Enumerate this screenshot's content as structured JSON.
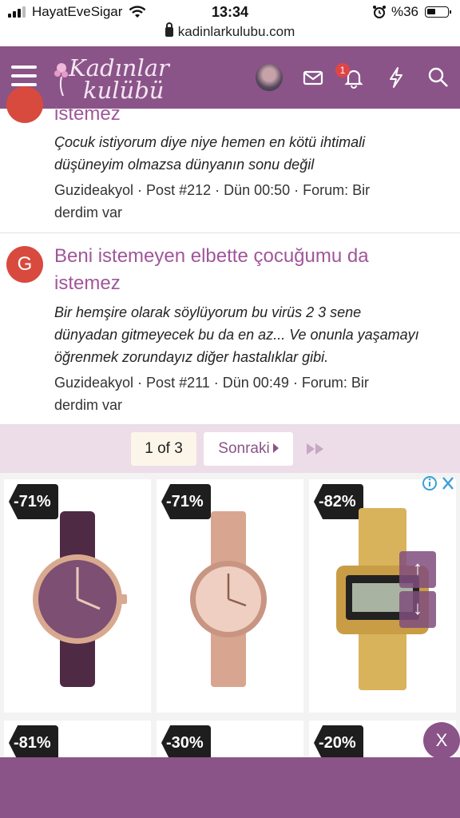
{
  "status_bar": {
    "carrier": "HayatEveSigar",
    "time": "13:34",
    "battery": "%36"
  },
  "browser": {
    "url": "kadinlarkulubu.com"
  },
  "header": {
    "logo_line1": "Kadınlar",
    "logo_line2": "kulübü",
    "notification_count": "1"
  },
  "results": [
    {
      "title_partial": "istemez",
      "snippet_line1": "Çocuk istiyorum diye niye hemen en kötü ihtimali",
      "snippet_line2": "düşüneyim olmazsa dünyanın sonu değil",
      "meta_line1": "Guzideakyol · Post #212 · Dün 00:50 · Forum: Bir",
      "meta_line2": "derdim var"
    },
    {
      "avatar_letter": "G",
      "title_line1": "Beni istemeyen elbette çocuğumu da",
      "title_line2": "istemez",
      "snippet_line1": "Bir hemşire olarak söylüyorum bu virüs 2 3 sene",
      "snippet_line2": "dünyadan gitmeyecek bu da en az... Ve onunla yaşamayı",
      "snippet_line3": "öğrenmek zorundayız diğer hastalıklar gibi.",
      "meta_line1": "Guzideakyol · Post #211 · Dün 00:49 · Forum: Bir",
      "meta_line2": "derdim var"
    }
  ],
  "pagination": {
    "current": "1 of 3",
    "next_label": "Sonraki"
  },
  "ad": {
    "discounts_row1": [
      "-71%",
      "-71%",
      "-82%"
    ],
    "discounts_row2": [
      "-81%",
      "-30%",
      "-20%"
    ],
    "close_label": "X"
  },
  "colors": {
    "brand": "#8a5488",
    "title_link": "#a0569a",
    "avatar_red": "#d84a3e",
    "pager_bg": "#ecdde9"
  },
  "icons": [
    "hamburger-icon",
    "mail-icon",
    "bell-icon",
    "lightning-icon",
    "search-icon",
    "lock-icon",
    "wifi-icon",
    "alarm-icon",
    "adchoices-icon",
    "arrow-up-icon",
    "arrow-down-icon",
    "fast-forward-icon"
  ]
}
